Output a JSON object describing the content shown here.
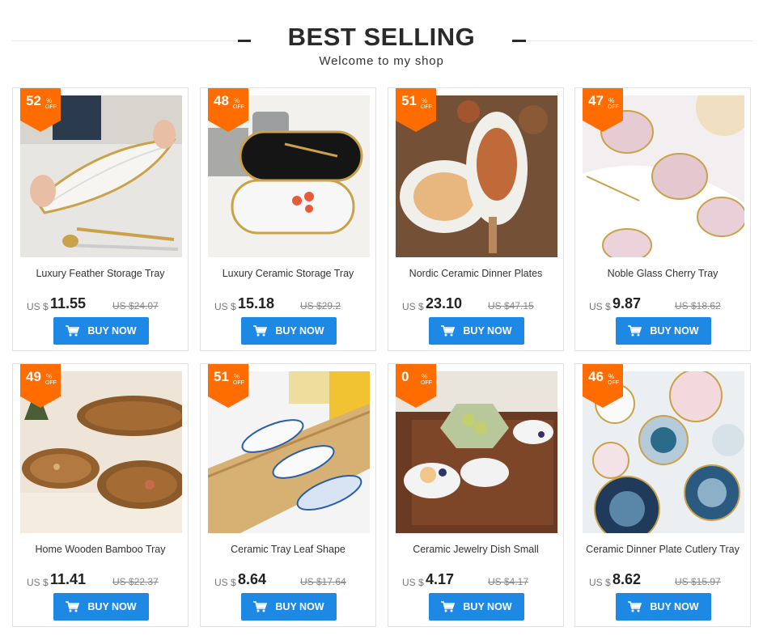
{
  "header": {
    "title": "BEST SELLING",
    "subtitle": "Welcome to my shop"
  },
  "colors": {
    "badge": "#ff6d00",
    "button": "#1e88e5",
    "text": "#333333"
  },
  "badge_pct": "%",
  "badge_off": "OFF",
  "currency": "US $",
  "buy_label": "BUY NOW",
  "products": [
    {
      "discount": "52",
      "name": "Luxury Feather Storage Tray",
      "price": "11.55",
      "old_price": "US $24.07",
      "image": "white glass feather tray with gold rim, gold cutlery"
    },
    {
      "discount": "48",
      "name": "Luxury Ceramic Storage Tray",
      "price": "15.18",
      "old_price": "US $29.2",
      "image": "oval marble and black trays with gold rim"
    },
    {
      "discount": "51",
      "name": "Nordic Ceramic Dinner Plates",
      "price": "23.10",
      "old_price": "US $47.15",
      "image": "painted ceramic plates on wooden table"
    },
    {
      "discount": "47",
      "name": "Noble Glass Cherry Tray",
      "price": "9.87",
      "old_price": "US $18.62",
      "image": "pink glass flower dishes on marble tray"
    },
    {
      "discount": "49",
      "name": "Home Wooden Bamboo Tray",
      "price": "11.41",
      "old_price": "US $22.37",
      "image": "wooden leaf trays with nuts"
    },
    {
      "discount": "51",
      "name": "Ceramic Tray Leaf Shape",
      "price": "8.64",
      "old_price": "US $17.64",
      "image": "blue leaf ceramic dishes on bamboo tray"
    },
    {
      "discount": "0",
      "name": "Ceramic Jewelry Dish Small",
      "price": "4.17",
      "old_price": "US $4.17",
      "image": "small ceramic dishes on wooden board"
    },
    {
      "discount": "46",
      "name": "Ceramic Dinner Plate Cutlery Tray",
      "price": "8.62",
      "old_price": "US $15.97",
      "image": "flower shaped glaze dishes"
    }
  ]
}
